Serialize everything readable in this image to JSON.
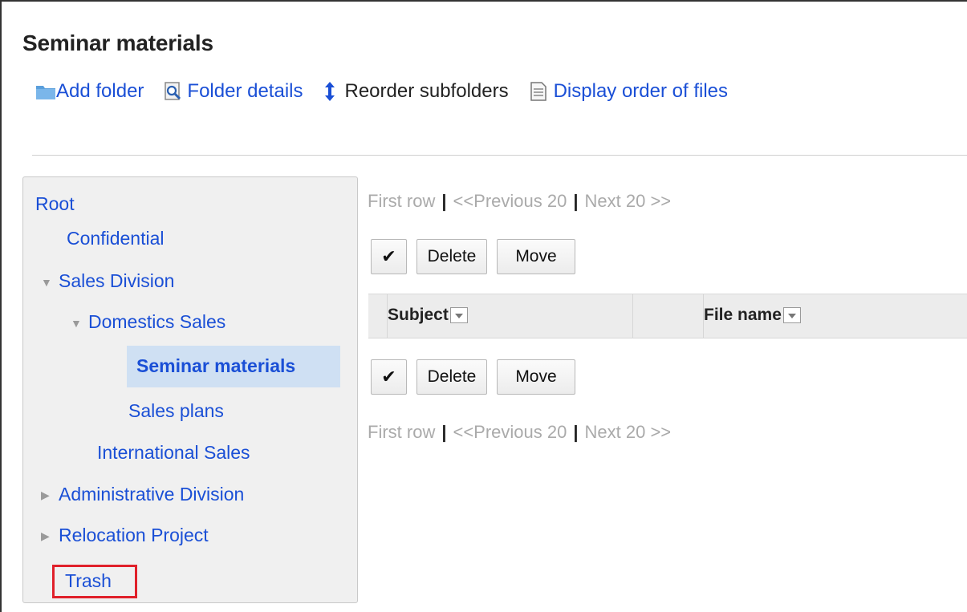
{
  "header": {
    "title": "Seminar materials"
  },
  "toolbar": {
    "add_folder": "Add folder",
    "folder_details": "Folder details",
    "reorder_subfolders": "Reorder subfolders",
    "display_order": "Display order of files"
  },
  "sidebar": {
    "root": "Root",
    "confidential": "Confidential",
    "sales_division": "Sales Division",
    "domestics_sales": "Domestics Sales",
    "seminar_materials": "Seminar materials",
    "sales_plans": "Sales plans",
    "international_sales": "International Sales",
    "administrative_division": "Administrative Division",
    "relocation_project": "Relocation Project",
    "trash": "Trash"
  },
  "pager": {
    "first_row": "First row",
    "previous": "<<Previous 20",
    "next": "Next 20 >>",
    "separator": "|"
  },
  "actions": {
    "check": "✔",
    "delete": "Delete",
    "move": "Move"
  },
  "table": {
    "columns": [
      "Subject",
      "File name"
    ]
  },
  "colors": {
    "link": "#1a4fd6",
    "selected_bg": "#cfe0f3",
    "highlight": "#e0202a"
  }
}
